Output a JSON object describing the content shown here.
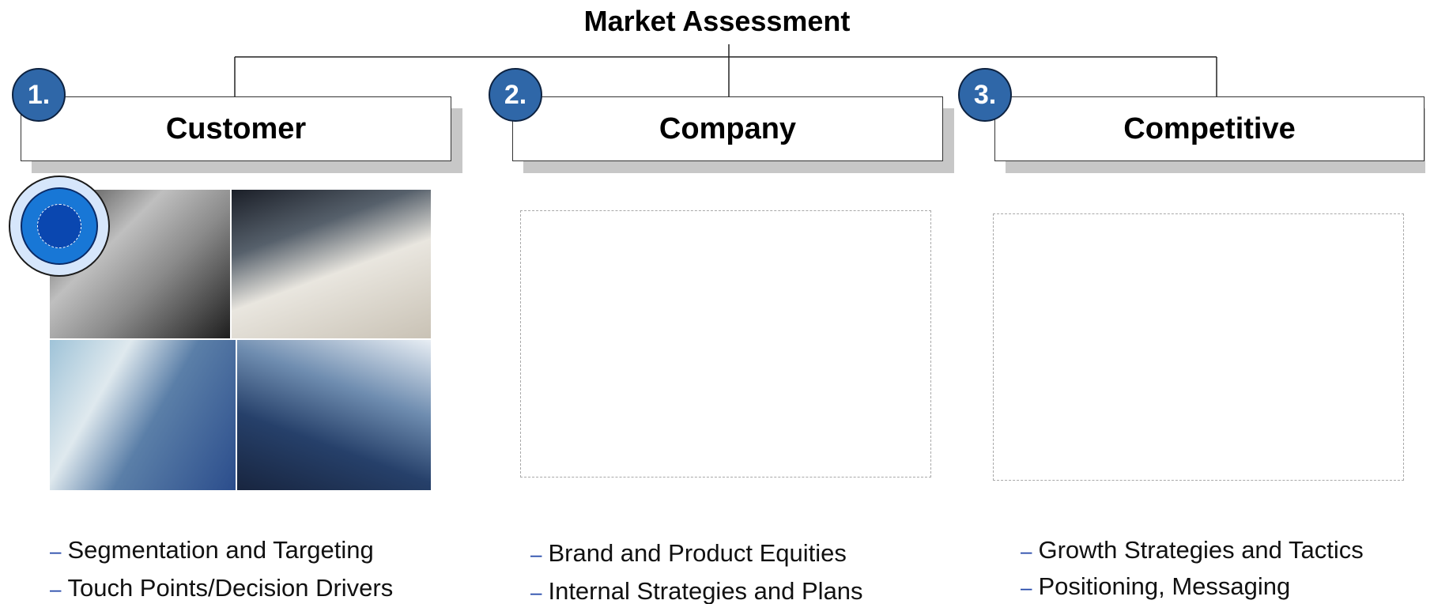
{
  "diagram": {
    "title": "Market Assessment",
    "columns": [
      {
        "number": "1.",
        "label": "Customer",
        "bullets": [
          "Segmentation and Targeting",
          "Touch Points/Decision Drivers"
        ]
      },
      {
        "number": "2.",
        "label": "Company",
        "bullets": [
          "Brand and Product Equities",
          "Internal Strategies and Plans"
        ]
      },
      {
        "number": "3.",
        "label": "Competitive",
        "bullets": [
          "Growth Strategies and Tactics",
          "Positioning, Messaging"
        ]
      }
    ]
  },
  "icons": {
    "bullet_marker": "dash",
    "target_ring": "target-ring-icon"
  },
  "colors": {
    "badge_fill": "#2f67a8",
    "bullet_dash": "#2246a8",
    "ring_outer": "#d6e6fb",
    "ring_mid": "#1877d6",
    "ring_core": "#0a47b0",
    "header_shadow": "#c7c7c7"
  }
}
